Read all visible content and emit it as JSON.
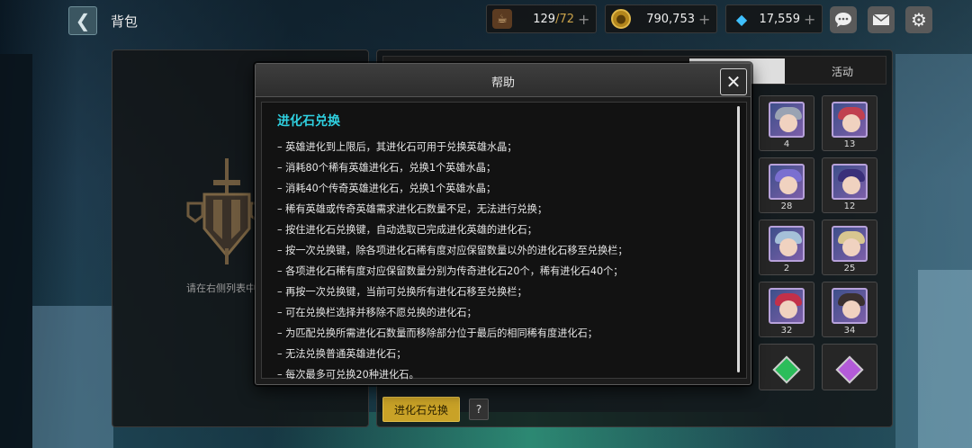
{
  "header": {
    "title": "背包",
    "back_icon": "chevron-left-icon"
  },
  "resources": {
    "stamina": {
      "icon": "coffee-cup-icon",
      "current": "129",
      "max": "/72"
    },
    "gold": {
      "icon": "gold-coin-icon",
      "value": "790,753"
    },
    "gems": {
      "icon": "diamond-icon",
      "value": "17,559"
    }
  },
  "top_icons": [
    "chat-icon",
    "mail-icon",
    "gear-icon"
  ],
  "left_panel": {
    "hint": "请在右侧列表中"
  },
  "tabs": {
    "active_label": "",
    "event_label": "活动"
  },
  "items": [
    {
      "count": "4",
      "hair": "#9aa3b3"
    },
    {
      "count": "13",
      "hair": "#c04050"
    },
    {
      "count": "28",
      "hair": "#7a6fd0"
    },
    {
      "count": "12",
      "hair": "#3a2f7a"
    },
    {
      "count": "2",
      "hair": "#a5c0d8"
    },
    {
      "count": "25",
      "hair": "#d8c690"
    },
    {
      "count": "32",
      "hair": "#c2304a"
    },
    {
      "count": "34",
      "hair": "#3a3030"
    },
    {
      "count": "",
      "stone": "#2bbd5a"
    },
    {
      "count": "",
      "stone": "#b35bd8"
    }
  ],
  "buttons": {
    "exchange": "进化石兑换",
    "help": "?"
  },
  "modal": {
    "title": "帮助",
    "close_icon": "close-icon",
    "section_title": "进化石兑换",
    "lines": [
      "英雄进化到上限后，其进化石可用于兑换英雄水晶；",
      "消耗80个稀有英雄进化石，兑换1个英雄水晶；",
      "消耗40个传奇英雄进化石，兑换1个英雄水晶；",
      "稀有英雄或传奇英雄需求进化石数量不足，无法进行兑换；",
      "按住进化石兑换键，自动选取已完成进化英雄的进化石；",
      "按一次兑换键，除各项进化石稀有度对应保留数量以外的进化石移至兑换栏；",
      "各项进化石稀有度对应保留数量分别为传奇进化石20个，稀有进化石40个；",
      "再按一次兑换键，当前可兑换所有进化石移至兑换栏；",
      "可在兑换栏选择并移除不愿兑换的进化石；",
      "为匹配兑换所需进化石数量而移除部分位于最后的相同稀有度进化石；",
      "无法兑换普通英雄进化石；",
      "每次最多可兑换20种进化石。"
    ]
  }
}
